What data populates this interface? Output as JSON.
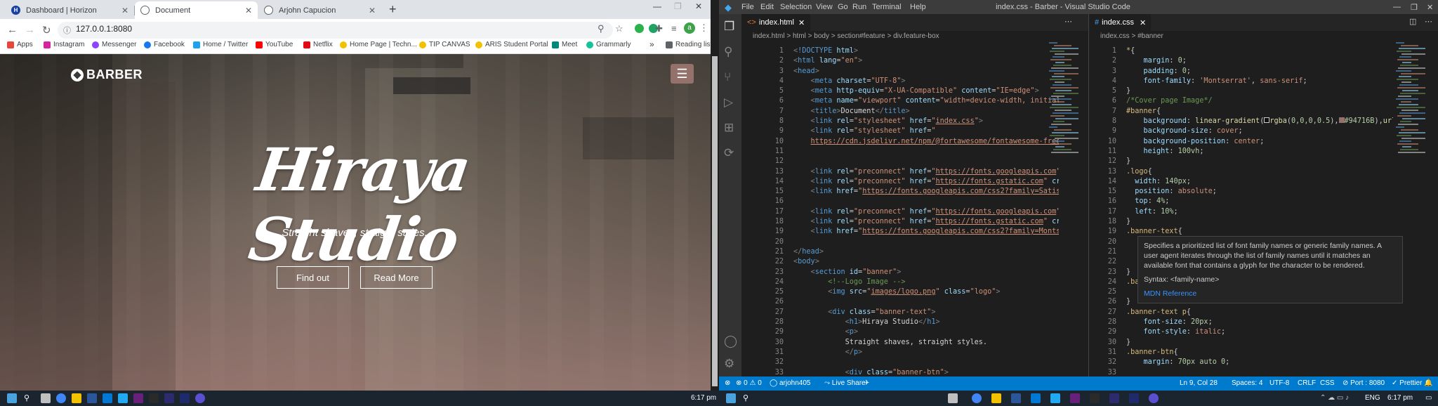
{
  "browser": {
    "tabs": [
      {
        "title": "Dashboard | Horizon",
        "active": false
      },
      {
        "title": "Document",
        "active": true
      },
      {
        "title": "Arjohn Capucion",
        "active": false
      }
    ],
    "url": "127.0.0.1:8080",
    "profile_initial": "a",
    "bookmarks": [
      {
        "label": "Apps",
        "color": "#e8453c"
      },
      {
        "label": "Instagram",
        "color": "#d6249f"
      },
      {
        "label": "Messenger",
        "color": "#8e44ff"
      },
      {
        "label": "Facebook",
        "color": "#1877f2"
      },
      {
        "label": "Home / Twitter",
        "color": "#1da1f2"
      },
      {
        "label": "YouTube",
        "color": "#ff0000"
      },
      {
        "label": "Netflix",
        "color": "#e50914"
      },
      {
        "label": "Home Page | Techn...",
        "color": "#f2c200"
      },
      {
        "label": "TIP CANVAS",
        "color": "#f2c200"
      },
      {
        "label": "ARIS Student Portal",
        "color": "#f2c200"
      },
      {
        "label": "Meet",
        "color": "#00897b"
      },
      {
        "label": "Grammarly",
        "color": "#15c39a"
      }
    ],
    "bookmarks_more": "»",
    "reading_list": "Reading list",
    "page": {
      "logo_text": "BARBER",
      "menu_icon": "☰",
      "hero_title": "Hiraya Studio",
      "hero_subtitle": "Straight shaves, straight styles.",
      "btn_find": "Find out",
      "btn_read": "Read More"
    }
  },
  "vscode": {
    "menu": [
      "File",
      "Edit",
      "Selection",
      "View",
      "Go",
      "Run",
      "Terminal",
      "Help"
    ],
    "window_title": "index.css - Barber - Visual Studio Code",
    "left_tab": "index.html",
    "right_tab": "index.css",
    "left_breadcrumb": "index.html > html > body > section#feature > div.feature-box",
    "right_breadcrumb": "index.css > #banner",
    "hover": {
      "text": "Specifies a prioritized list of font family names or generic family names. A user agent iterates through the list of family names until it matches an available font that contains a glyph for the character to be rendered.",
      "syntax": "Syntax: <family-name>",
      "link": "MDN Reference"
    },
    "status": {
      "errors": "0",
      "warnings": "0",
      "user": "arjohn405",
      "live_share": "Live Share",
      "position": "Ln 9, Col 28",
      "spaces": "Spaces: 4",
      "encoding": "UTF-8",
      "eol": "CRLF",
      "language": "CSS",
      "port": "Port : 8080",
      "prettier": "Prettier"
    }
  },
  "taskbar": {
    "clock_left": "6:17 pm",
    "clock_right": "6:17 pm",
    "lang": "ENG"
  }
}
